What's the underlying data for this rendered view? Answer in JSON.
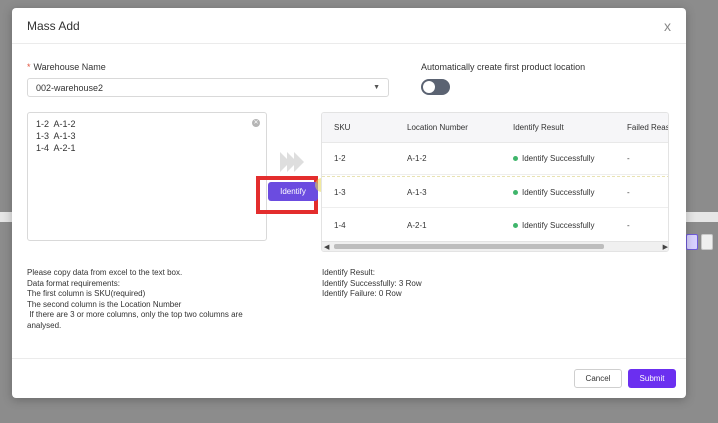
{
  "dialog": {
    "title": "Mass Add",
    "close_label": "x"
  },
  "warehouse": {
    "label": "Warehouse Name",
    "required_mark": "*",
    "selected": "002-warehouse2"
  },
  "auto_location": {
    "label": "Automatically create first product location",
    "enabled": false
  },
  "input": {
    "lines": [
      "1-2  A-1-2",
      "1-3  A-1-3",
      "1-4  A-2-1"
    ]
  },
  "identify_button": "Identify",
  "table": {
    "headers": [
      "SKU",
      "Location Number",
      "Identify Result",
      "Failed Reas"
    ],
    "rows": [
      {
        "sku": "1-2",
        "location": "A-1-2",
        "result": "Identify Successfully",
        "failed": "-"
      },
      {
        "sku": "1-3",
        "location": "A-1-3",
        "result": "Identify Successfully",
        "failed": "-"
      },
      {
        "sku": "1-4",
        "location": "A-2-1",
        "result": "Identify Successfully",
        "failed": "-"
      }
    ],
    "status_color": "#3fb56b"
  },
  "notes": [
    "Please copy data from excel to the text box.",
    "Data format requirements:",
    "The first column is SKU(required)",
    "The second column is the Location Number",
    " If there are 3 or more columns, only the top two columns are",
    "analysed."
  ],
  "result_summary": {
    "title": "Identify Result:",
    "success": "Identify Successfully: 3 Row",
    "failure": "Identify Failure: 0 Row"
  },
  "footer": {
    "cancel_label": "Cancel",
    "submit_label": "Submit"
  },
  "colors": {
    "accent": "#6b2ff0",
    "highlight": "#e32d2d"
  }
}
